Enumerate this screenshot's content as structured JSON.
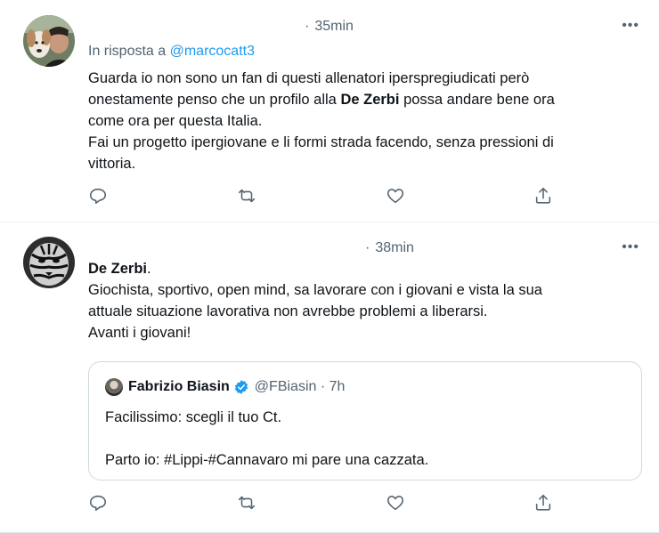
{
  "tweets": [
    {
      "time": "35min",
      "more": "•••",
      "reply_prefix": "In risposta a",
      "reply_handle": "@marcocatt3",
      "lines": [
        [
          "Guarda io non sono un fan di questi allenatori iperspregiudicati però"
        ],
        [
          "onestamente penso che  un profilo alla ",
          "De Zerbi",
          " possa andare bene ora"
        ],
        [
          "come ora per questa Italia."
        ],
        [
          "Fai un progetto ipergiovane e li formi strada facendo, senza pressioni di"
        ],
        [
          "vittoria."
        ]
      ]
    },
    {
      "time": "38min",
      "more": "•••",
      "lines": [
        [
          "De Zerbi",
          "."
        ],
        [
          "Giochista, sportivo, open mind, sa lavorare con i giovani e vista la sua"
        ],
        [
          "attuale situazione lavorativa non avrebbe problemi a liberarsi."
        ],
        [
          "Avanti i giovani!"
        ]
      ],
      "quote": {
        "name": "Fabrizio Biasin",
        "handle": "@FBiasin",
        "time": "7h",
        "text1": "Facilissimo: scegli il tuo Ct.",
        "text2": "Parto io: #Lippi-#Cannavaro mi pare una cazzata."
      }
    }
  ],
  "colors": {
    "text": "#0f1419",
    "muted": "#536471",
    "link": "#1d9bf0",
    "border": "#cfd9de"
  },
  "icons": [
    "reply-icon",
    "retweet-icon",
    "like-icon",
    "share-icon",
    "more-icon",
    "verified-badge-icon"
  ]
}
